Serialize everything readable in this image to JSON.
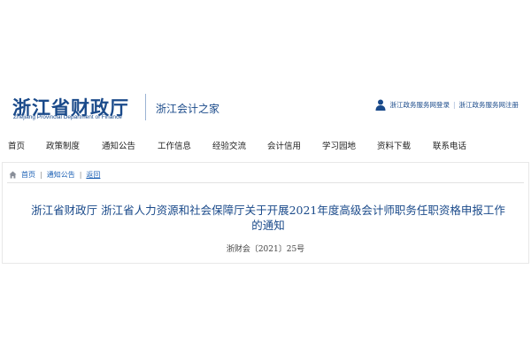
{
  "header": {
    "logo_title": "浙江省财政厅",
    "logo_subtitle": "Zhejiang Provincial Department of Finance",
    "site_name": "浙江会计之家",
    "login_link": "浙江政务服务网登录",
    "separator": "|",
    "register_link": "浙江政务服务网注册",
    "user_icon": "user-icon"
  },
  "nav": {
    "items": [
      {
        "label": "首页"
      },
      {
        "label": "政策制度"
      },
      {
        "label": "通知公告"
      },
      {
        "label": "工作信息"
      },
      {
        "label": "经验交流"
      },
      {
        "label": "会计信用"
      },
      {
        "label": "学习园地"
      },
      {
        "label": "资料下载"
      },
      {
        "label": "联系电话"
      }
    ]
  },
  "breadcrumb": {
    "home_icon": "home-icon",
    "home": "首页",
    "separator": "|",
    "section": "通知公告",
    "current": "返回"
  },
  "article": {
    "title": "浙江省财政厅 浙江省人力资源和社会保障厅关于开展2021年度高级会计师职务任职资格申报工作的通知",
    "doc_number": "浙财会〔2021〕25号"
  },
  "colors": {
    "brand_blue": "#1a4a8a",
    "link_blue": "#1a5fb4"
  }
}
